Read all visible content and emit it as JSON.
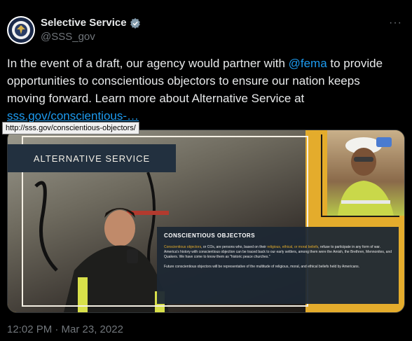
{
  "author": {
    "display_name": "Selective Service",
    "handle": "@SSS_gov",
    "verified_icon": "verified-badge-icon"
  },
  "tweet": {
    "text_before": "In the event of a draft, our agency would partner with ",
    "mention": "@fema",
    "text_after": " to provide opportunities to conscientious objectors to ensure our nation keeps moving forward. Learn more about Alternative Service at ",
    "url_text": "sss.gov/conscientious-…",
    "tooltip": "http://sss.gov/conscientious-objectors/"
  },
  "media": {
    "banner_title": "ALTERNATIVE SERVICE",
    "box_title": "CONSCIENTIOUS OBJECTORS",
    "box_text_hl1": "Conscientious objectors",
    "box_text_1": ", or COs, are persons who, based on their ",
    "box_text_hl2": "religious, ethical, or moral beliefs",
    "box_text_2": ", refuse to participate in any form of war. America's history with conscientious objection can be traced back to our early settlers, among them were the Amish, the Brethren, Mennonites, and Quakers. We have come to know them as \"historic peace churches.\"",
    "box_text_3": "Future conscientious objectors will be representative of the multitude of religious, moral, and ethical beliefs held by ",
    "box_text_hl3": "Americans",
    "box_text_4": "."
  },
  "meta": {
    "timestamp": "12:02 PM · Mar 23, 2022"
  },
  "colors": {
    "background": "#000000",
    "link": "#1d9bf0",
    "accent_gold": "#e4ac2c",
    "banner_navy": "#22303f"
  }
}
